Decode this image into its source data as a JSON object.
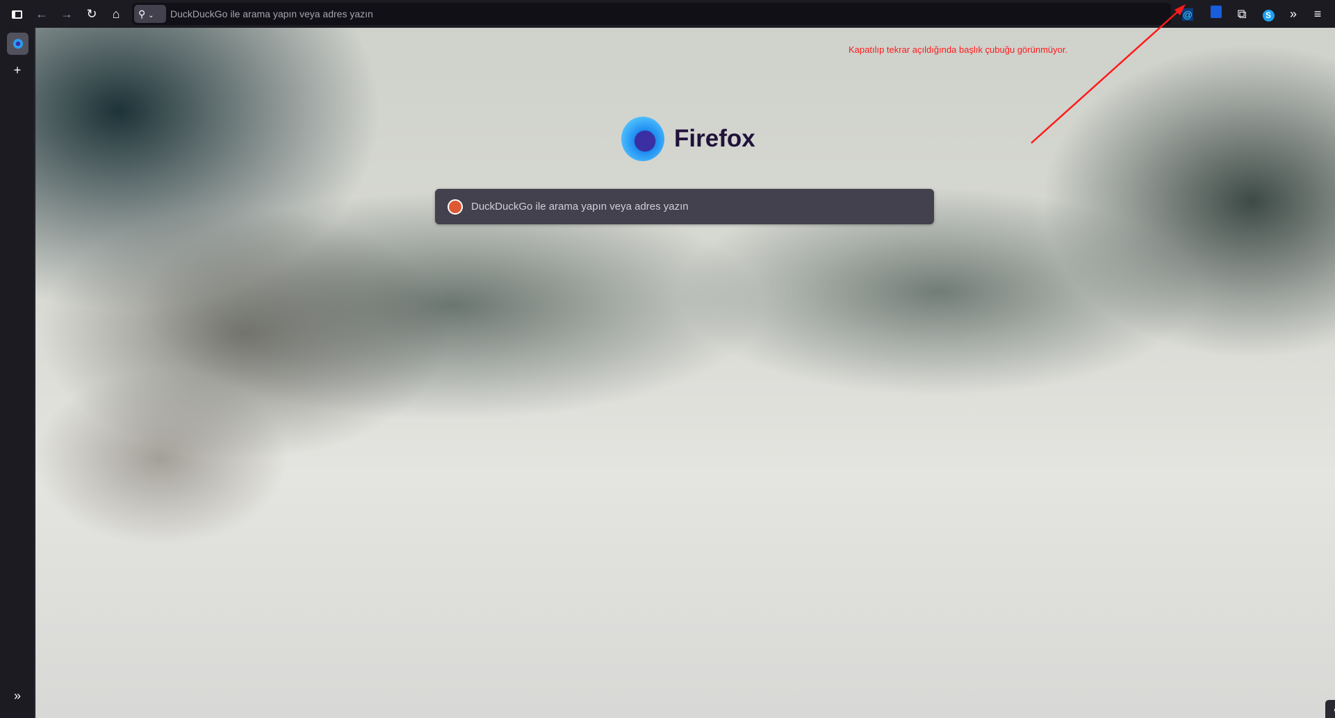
{
  "toolbar": {
    "icons": [
      "sidebar-toggle-icon",
      "back-icon",
      "forward-icon",
      "reload-icon",
      "home-icon"
    ],
    "url_placeholder": "DuckDuckGo ile arama yapın veya adres yazın",
    "extensions": [
      "email-relay-icon",
      "bitwarden-icon",
      "extensions-icon",
      "skype-icon",
      "overflow-icon",
      "menu-icon"
    ]
  },
  "newtab": {
    "logo_text": "Firefox",
    "search_placeholder": "DuckDuckGo ile arama yapın veya adres yazın"
  },
  "annotation": {
    "text": "Kapatılıp tekrar açıldığında başlık çubuğu görünmüyor.",
    "color": "#ff1a1a"
  }
}
